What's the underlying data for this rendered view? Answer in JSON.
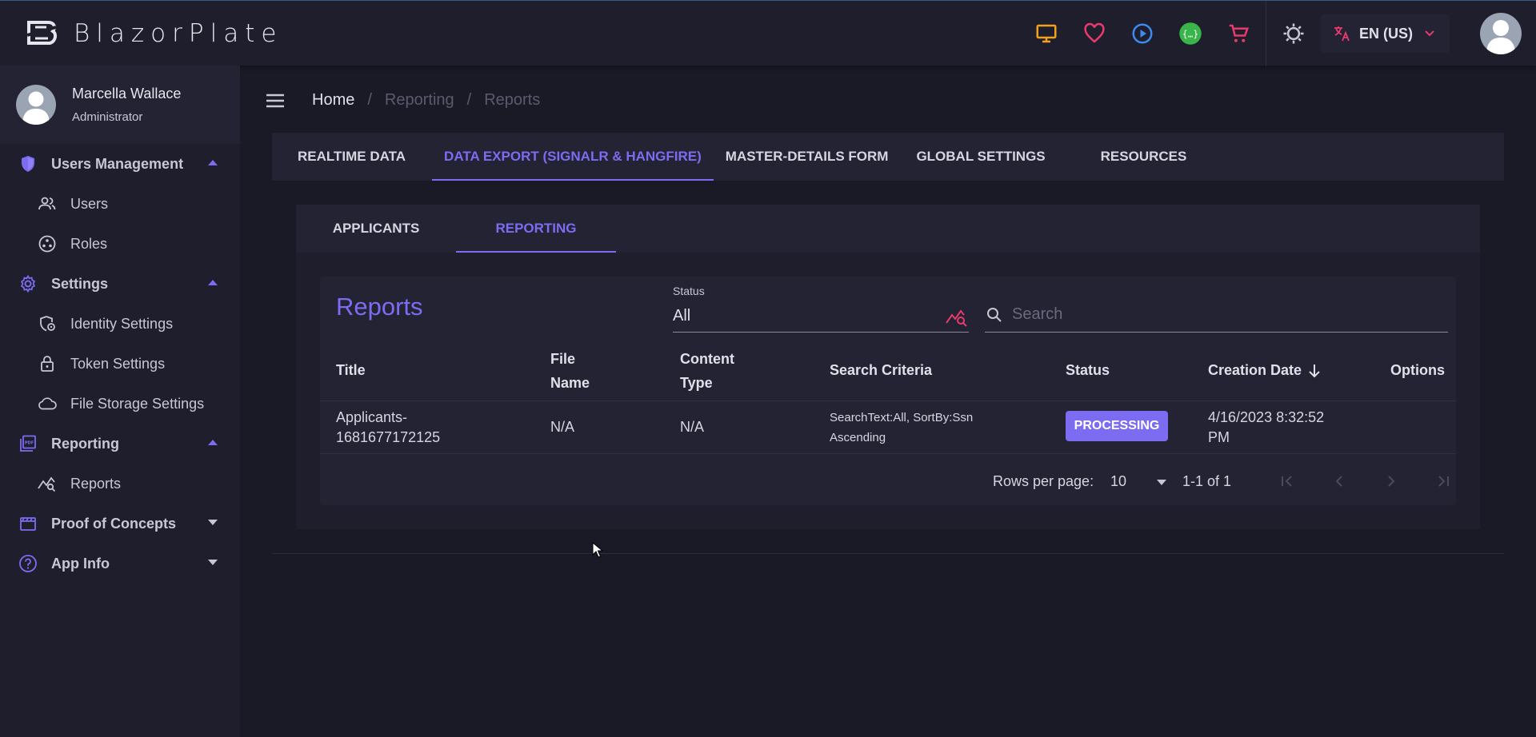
{
  "app": {
    "brand": "BlazorPlate",
    "language_label": "EN (US)"
  },
  "topbar": {
    "icons": [
      "monitor-icon",
      "heart-icon",
      "play-circle-icon",
      "api-icon",
      "cart-icon",
      "theme-icon",
      "translate-icon"
    ],
    "colors": {
      "monitor": "#f2a21a",
      "heart": "#e83a6b",
      "play": "#3d8bf2",
      "api": "#3ab54a",
      "cart": "#e83a6b"
    }
  },
  "profile": {
    "name": "Marcella Wallace",
    "role": "Administrator"
  },
  "sidebar": {
    "groups": [
      {
        "label": "Users Management",
        "items": [
          {
            "label": "Users"
          },
          {
            "label": "Roles"
          }
        ]
      },
      {
        "label": "Settings",
        "items": [
          {
            "label": "Identity Settings"
          },
          {
            "label": "Token Settings"
          },
          {
            "label": "File Storage Settings"
          }
        ]
      },
      {
        "label": "Reporting",
        "items": [
          {
            "label": "Reports"
          }
        ]
      },
      {
        "label": "Proof of Concepts",
        "items": []
      },
      {
        "label": "App Info",
        "items": []
      }
    ]
  },
  "breadcrumb": [
    "Home",
    "Reporting",
    "Reports"
  ],
  "top_tabs": [
    "REALTIME DATA",
    "DATA EXPORT (SIGNALR & HANGFIRE)",
    "MASTER-DETAILS FORM",
    "GLOBAL SETTINGS",
    "RESOURCES"
  ],
  "sub_tabs": [
    "APPLICANTS",
    "REPORTING"
  ],
  "reports": {
    "title": "Reports",
    "status_label": "Status",
    "status_value": "All",
    "search_placeholder": "Search",
    "columns": {
      "title": "Title",
      "file_name_1": "File",
      "file_name_2": "Name",
      "content_type_1": "Content",
      "content_type_2": "Type",
      "search_criteria": "Search Criteria",
      "status": "Status",
      "creation_date": "Creation Date",
      "options": "Options"
    },
    "rows": [
      {
        "title_1": "Applicants-",
        "title_2": "1681677172125",
        "file_name": "N/A",
        "content_type": "N/A",
        "criteria_1": "SearchText:All, SortBy:Ssn",
        "criteria_2": "Ascending",
        "status": "PROCESSING",
        "date_1": "4/16/2023 8:32:52",
        "date_2": "PM"
      }
    ],
    "pager": {
      "rows_per_page_label": "Rows per page:",
      "rows_per_page": "10",
      "range": "1-1 of 1"
    }
  },
  "accent_color": "#7c6cf2"
}
